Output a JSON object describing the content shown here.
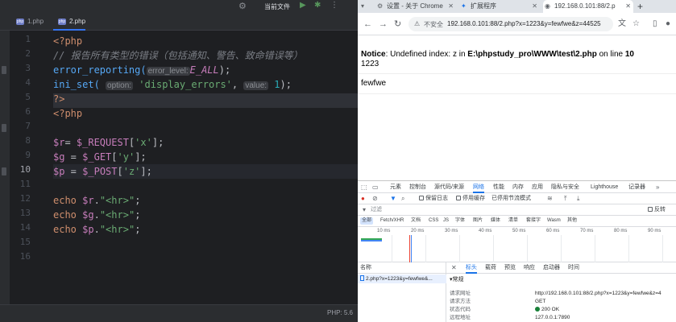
{
  "ide": {
    "run_config": "当前文件",
    "tabs": [
      {
        "label": "1.php",
        "icon": "php-file-icon"
      },
      {
        "label": "2.php",
        "icon": "php-file-icon"
      }
    ],
    "line_numbers": [
      "1",
      "2",
      "3",
      "4",
      "5",
      "6",
      "7",
      "8",
      "9",
      "10",
      "11",
      "12",
      "13",
      "14",
      "15",
      "16"
    ],
    "code": {
      "l1": "<?php",
      "l2": "// 报告所有类型的错误（包括通知、警告、致命错误等）",
      "l3_fn": "error_reporting(",
      "l3_hint": "error_level:",
      "l3_const": "E_ALL",
      "l3_end": ");",
      "l4_fn": "ini_set(",
      "l4_hint1": "option:",
      "l4_str": "'display_errors'",
      "l4_comma": ",",
      "l4_hint2": "value:",
      "l4_num": "1",
      "l4_end": ");",
      "l5": "?>",
      "l6": "<?php",
      "l8_var": "$r",
      "l8_rest": "= ",
      "l8_sg": "$_REQUEST",
      "l8_key": "'x'",
      "l9_var": "$g",
      "l9_sg": "$_GET",
      "l9_key": "'y'",
      "l10_var": "$p",
      "l10_sg": "$_POST",
      "l10_key": "'z'",
      "l12_kw": "echo",
      "l12_var": "$r",
      "l12_str": "\"<hr>\"",
      "l13_kw": "echo",
      "l13_var": "$g",
      "l13_str": "\"<hr>\"",
      "l14_kw": "echo",
      "l14_var": "$p",
      "l14_str": "\"<hr>\""
    },
    "status_php": "PHP: 5.6"
  },
  "browser": {
    "tabs": [
      {
        "label": "设置 - 关于 Chrome",
        "icon": "gear-icon"
      },
      {
        "label": "扩展程序",
        "icon": "puzzle-icon"
      },
      {
        "label": "192.168.0.101:88/2.p",
        "icon": "globe-icon"
      }
    ],
    "omnibox": {
      "insecure_label": "不安全",
      "url": "192.168.0.101:88/2.php?x=1223&y=fewfwe&z=44525"
    },
    "page": {
      "notice_label": "Notice",
      "notice_text": ": Undefined index: z in ",
      "notice_path": "E:\\phpstudy_pro\\WWW\\test\\2.php",
      "notice_on": " on line ",
      "notice_line": "10",
      "out1": "1223",
      "out2": "fewfwe"
    },
    "devtools": {
      "tabs": [
        "元素",
        "控制台",
        "源代码/来源",
        "网络",
        "性能",
        "内存",
        "应用",
        "隐私与安全",
        "Lighthouse",
        "记录器"
      ],
      "active_tab": "网络",
      "row2": {
        "preserve_log": "保留日志",
        "disable_cache": "停用缓存",
        "throttle": "已停用节流模式"
      },
      "filter_placeholder": "过滤",
      "invert": "反转",
      "type_filters": [
        "全部",
        "Fetch/XHR",
        "文档",
        "CSS",
        "JS",
        "字体",
        "图片",
        "媒体",
        "清单",
        "套接字",
        "Wasm",
        "其他"
      ],
      "timeline_ticks": [
        "10 ms",
        "20 ms",
        "30 ms",
        "40 ms",
        "50 ms",
        "60 ms",
        "70 ms",
        "80 ms",
        "90 ms"
      ],
      "list_header": "名称",
      "request_name": "2.php?x=1223&y=fewfwe&...",
      "detail_tabs": [
        "标头",
        "载荷",
        "预览",
        "响应",
        "启动器",
        "时间"
      ],
      "section_general": "▾常规",
      "fields": [
        {
          "k": "请求网址",
          "v": "http://192.168.0.101:88/2.php?x=1223&y=fewfwe&z=4"
        },
        {
          "k": "请求方法",
          "v": "GET"
        },
        {
          "k": "状态代码",
          "v": "200 OK"
        },
        {
          "k": "远程地址",
          "v": "127.0.0.1:7890"
        }
      ]
    }
  }
}
